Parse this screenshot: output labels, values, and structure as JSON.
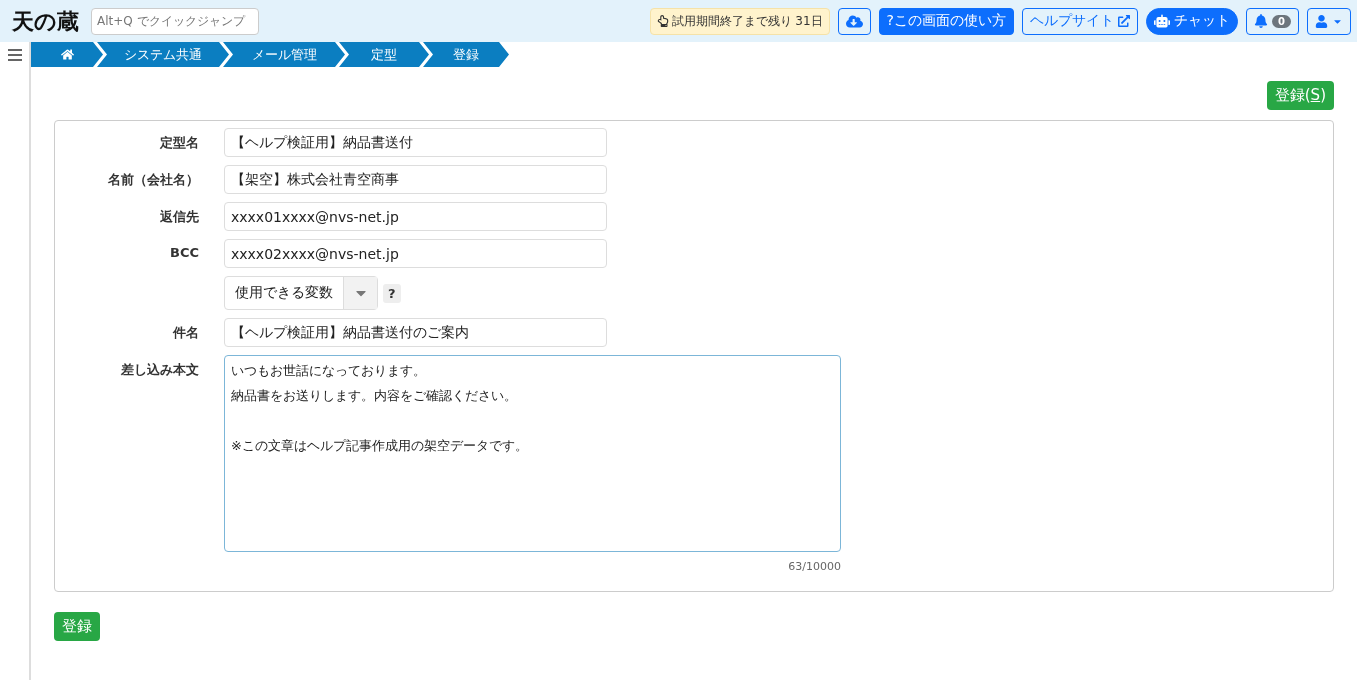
{
  "header": {
    "logo": "天の蔵",
    "quick_jump": {
      "placeholder": "Alt+Q でクイックジャンプ"
    },
    "trial_notice": "試用期間終了まで残り 31日",
    "help_button": "?この画面の使い方",
    "help_site": "ヘルプサイト",
    "chat": "チャット",
    "notification_count": "0"
  },
  "breadcrumb": [
    "システム共通",
    "メール管理",
    "定型",
    "登録"
  ],
  "top_action": {
    "parts": [
      {
        "text": "登録(",
        "underline": false
      },
      {
        "text": "S",
        "underline": true
      },
      {
        "text": ")",
        "underline": false
      }
    ]
  },
  "form": {
    "fields": [
      {
        "kind": "text",
        "label": "定型名",
        "value": "【ヘルプ検証用】納品書送付"
      },
      {
        "kind": "text",
        "label": "名前（会社名）",
        "value": "【架空】株式会社青空商事"
      },
      {
        "kind": "text",
        "label": "返信先",
        "value": "xxxx01xxxx@nvs-net.jp"
      },
      {
        "kind": "text",
        "label": "BCC",
        "value": "xxxx02xxxx@nvs-net.jp"
      },
      {
        "kind": "select",
        "value": "使用できる変数",
        "help": "?"
      },
      {
        "kind": "text",
        "label": "件名",
        "value": "【ヘルプ検証用】納品書送付のご案内"
      },
      {
        "kind": "textarea",
        "label": "差し込み本文",
        "paragraphs": [
          [
            "いつもお世話になっております。",
            "納品書をお送りします。内容をご確認ください。"
          ],
          [
            "※この文章はヘルプ記事作成用の架空データです。"
          ]
        ],
        "counter": "63/10000"
      }
    ]
  },
  "submit": "登録"
}
